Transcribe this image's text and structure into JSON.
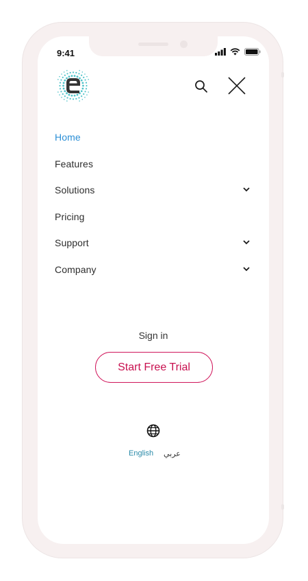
{
  "status_bar": {
    "time": "9:41",
    "icons": [
      "signal-icon",
      "wifi-icon",
      "battery-icon"
    ]
  },
  "header": {
    "logo_icon": "e-dots-logo",
    "search_icon": "search-icon",
    "close_icon": "close-icon"
  },
  "menu": {
    "items": [
      {
        "label": "Home",
        "active": true,
        "has_submenu": false
      },
      {
        "label": "Features",
        "active": false,
        "has_submenu": false
      },
      {
        "label": "Solutions",
        "active": false,
        "has_submenu": true
      },
      {
        "label": "Pricing",
        "active": false,
        "has_submenu": false
      },
      {
        "label": "Support",
        "active": false,
        "has_submenu": true
      },
      {
        "label": "Company",
        "active": false,
        "has_submenu": true
      }
    ]
  },
  "auth": {
    "sign_in_label": "Sign in",
    "trial_label": "Start Free Trial"
  },
  "language": {
    "icon": "globe-icon",
    "english": "English",
    "arabic": "عربي"
  },
  "colors": {
    "accent_blue": "#2b8fd6",
    "brand_pink": "#c8104f",
    "teal": "#2a8aa8",
    "logo_dots": "#4fc3c9"
  }
}
